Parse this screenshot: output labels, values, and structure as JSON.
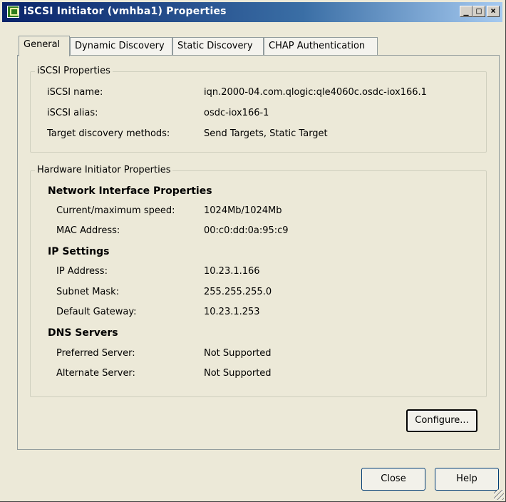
{
  "window": {
    "title": "iSCSI Initiator (vmhba1) Properties",
    "minimize_label": "_",
    "maximize_label": "□",
    "close_label": "×"
  },
  "tabs": [
    {
      "label": "General",
      "active": true
    },
    {
      "label": "Dynamic Discovery",
      "active": false
    },
    {
      "label": "Static Discovery",
      "active": false
    },
    {
      "label": "CHAP Authentication",
      "active": false
    }
  ],
  "iscsi_properties": {
    "title": "iSCSI Properties",
    "rows": [
      {
        "label": "iSCSI name:",
        "value": "iqn.2000-04.com.qlogic:qle4060c.osdc-iox166.1"
      },
      {
        "label": "iSCSI alias:",
        "value": "osdc-iox166-1"
      },
      {
        "label": "Target discovery methods:",
        "value": "Send Targets, Static Target"
      }
    ]
  },
  "hardware_properties": {
    "title": "Hardware Initiator Properties",
    "network": {
      "heading": "Network Interface Properties",
      "rows": [
        {
          "label": "Current/maximum speed:",
          "value": "1024Mb/1024Mb"
        },
        {
          "label": "MAC Address:",
          "value": "00:c0:dd:0a:95:c9"
        }
      ]
    },
    "ip": {
      "heading": "IP Settings",
      "rows": [
        {
          "label": "IP Address:",
          "value": "10.23.1.166"
        },
        {
          "label": "Subnet Mask:",
          "value": "255.255.255.0"
        },
        {
          "label": "Default Gateway:",
          "value": "10.23.1.253"
        }
      ]
    },
    "dns": {
      "heading": "DNS Servers",
      "rows": [
        {
          "label": "Preferred Server:",
          "value": "Not Supported"
        },
        {
          "label": "Alternate Server:",
          "value": "Not Supported"
        }
      ]
    }
  },
  "buttons": {
    "configure": "Configure...",
    "close": "Close",
    "help": "Help"
  }
}
